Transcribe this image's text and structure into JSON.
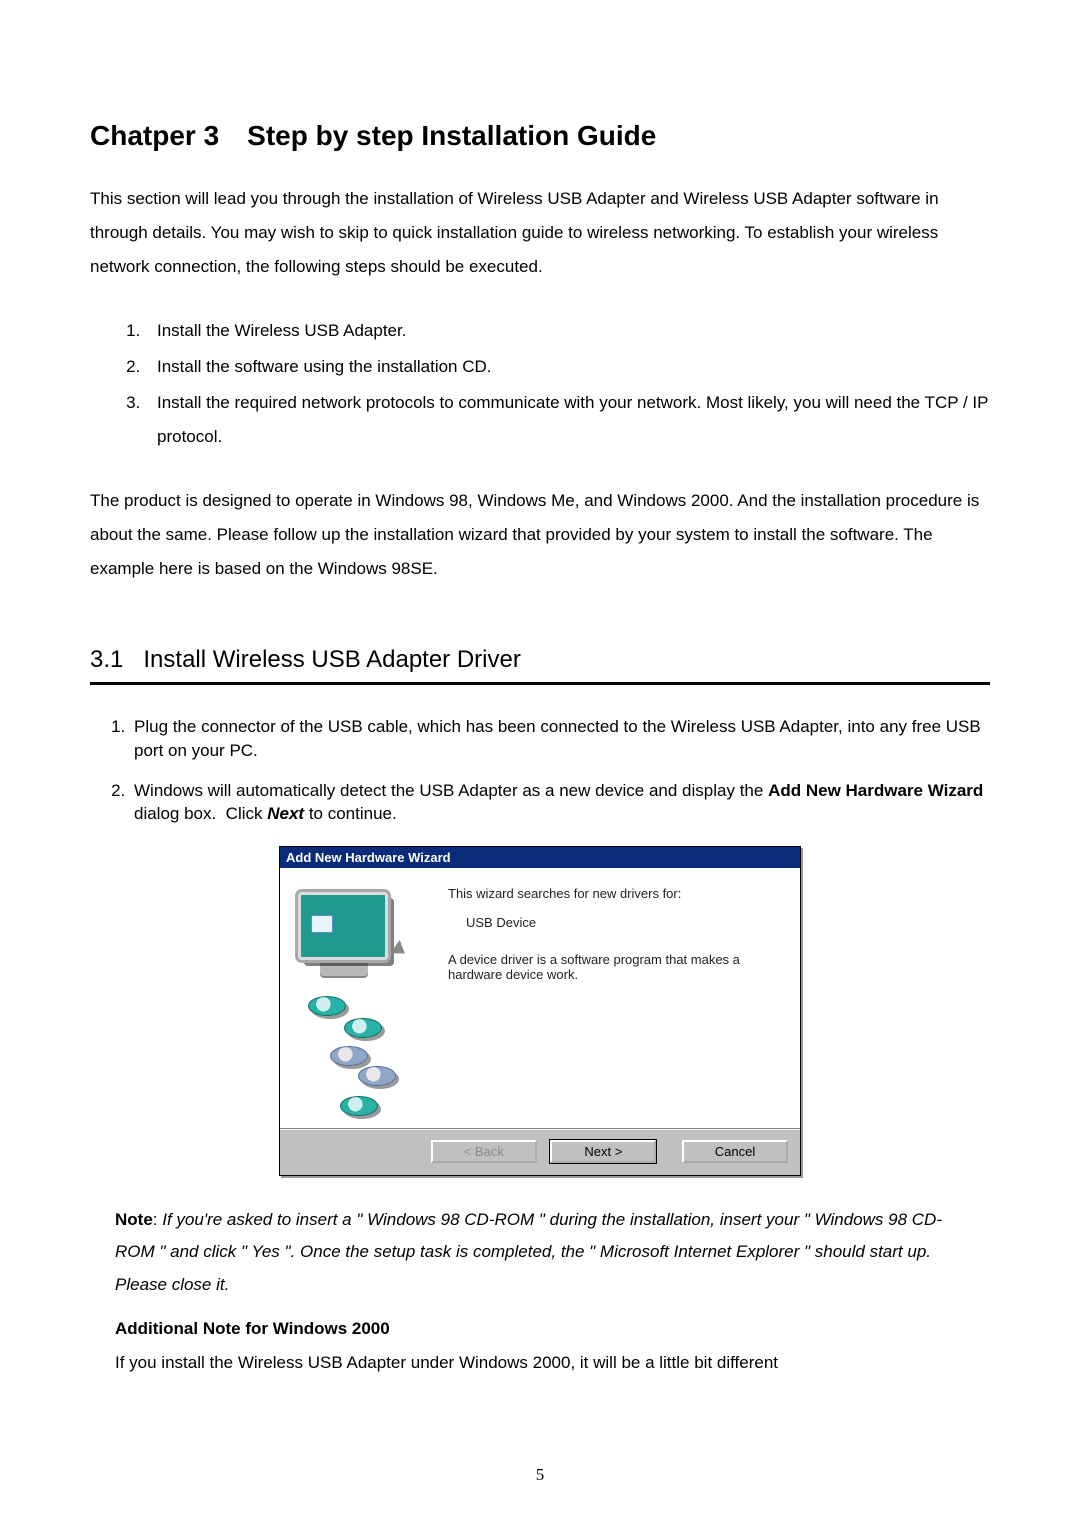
{
  "chapterTitle": "Chatper 3 Step by step Installation Guide",
  "intro": "This section will lead you through the installation of Wireless USB Adapter and Wireless USB Adapter software in through details. You may wish to skip to quick installation guide to wireless networking. To establish your wireless network connection, the following steps should be executed.",
  "steps": [
    "Install the Wireless USB Adapter.",
    "Install the software using the installation CD.",
    "Install the required network protocols to communicate with your network. Most likely, you will need the TCP / IP protocol."
  ],
  "osNote": "The product is designed to operate in Windows 98, Windows Me, and Windows 2000. And the installation procedure is about the same. Please follow up the installation wizard that provided by your system to install the software. The example here is based on the Windows 98SE.",
  "section": {
    "number": "3.1",
    "title": "Install Wireless USB Adapter Driver"
  },
  "substeps": {
    "s1": "Plug the connector of the USB cable, which has been connected to the Wireless USB Adapter, into any free USB port on your PC.",
    "s2_pre": "Windows will automatically detect the USB Adapter as a new device and display the ",
    "s2_bold": "Add New Hardware Wizard",
    "s2_mid": " dialog box.  Click ",
    "s2_next": "Next",
    "s2_post": " to continue."
  },
  "wizard": {
    "title": "Add New Hardware Wizard",
    "line1": "This wizard searches for new drivers for:",
    "device": "USB Device",
    "line2": "A device driver is a software program that makes a hardware device work.",
    "buttons": {
      "back": "< Back",
      "next": "Next >",
      "cancel": "Cancel"
    }
  },
  "note": {
    "label": "Note",
    "colon": ": ",
    "text": "If you're asked to insert a \" Windows 98 CD-ROM \" during the installation, insert your \" Windows 98 CD-ROM \" and click \" Yes \". Once the setup task is completed, the \" Microsoft Internet Explorer \" should start up. Please close it."
  },
  "addNote": {
    "heading": "Additional Note for Windows 2000",
    "text": "If you install the Wireless USB Adapter under Windows 2000, it will be a little bit different"
  },
  "pageNumber": "5"
}
